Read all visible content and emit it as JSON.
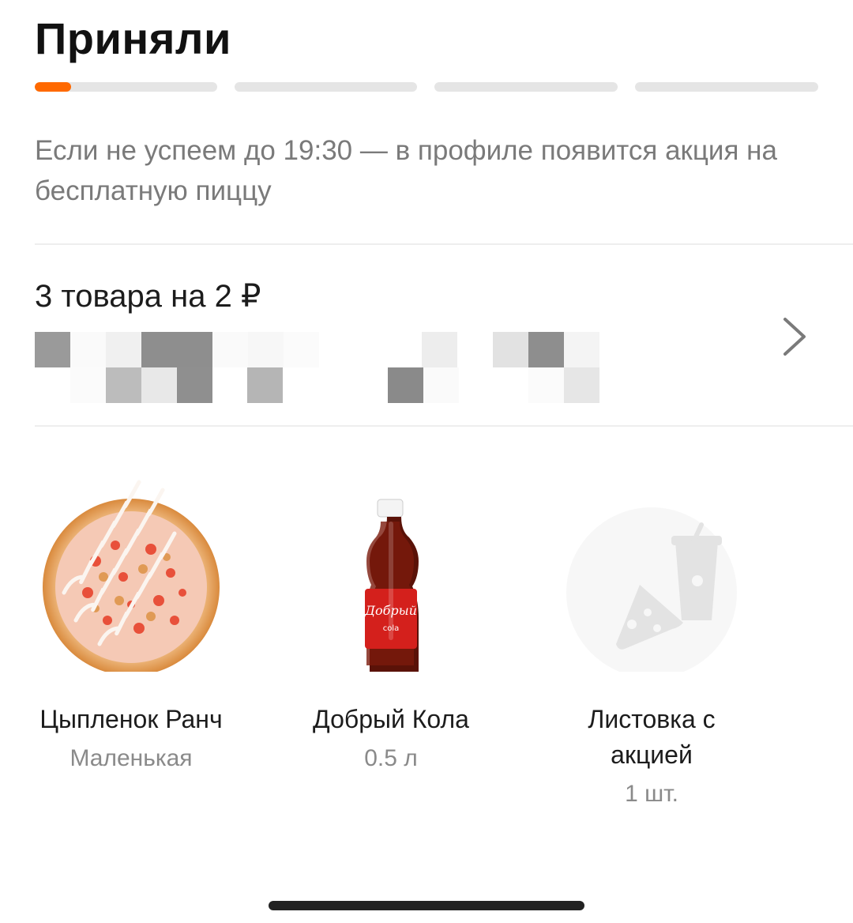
{
  "status": {
    "title": "Приняли",
    "progress": {
      "segments": 4,
      "active_segment": 1,
      "active_fill": 0.2,
      "active_color": "#ff6900"
    },
    "notice": "Если не успеем до 19:30 — в профиле появится акция на бесплатную пиццу"
  },
  "order": {
    "summary": "3 товара на 2 ₽",
    "address_redacted": true
  },
  "products": [
    {
      "name": "Цыпленок Ранч",
      "detail": "Маленькая",
      "icon": "pizza-image"
    },
    {
      "name": "Добрый Кола",
      "detail": "0.5 л",
      "icon": "cola-bottle-image",
      "label_text": "Добрый",
      "label_sub": "cola"
    },
    {
      "name": "Листовка с акцией",
      "detail": "1 шт.",
      "icon": "promo-placeholder-icon"
    }
  ],
  "colors": {
    "accent": "#ff6900",
    "muted_text": "#8a8a8a",
    "track": "#e5e5e5"
  }
}
